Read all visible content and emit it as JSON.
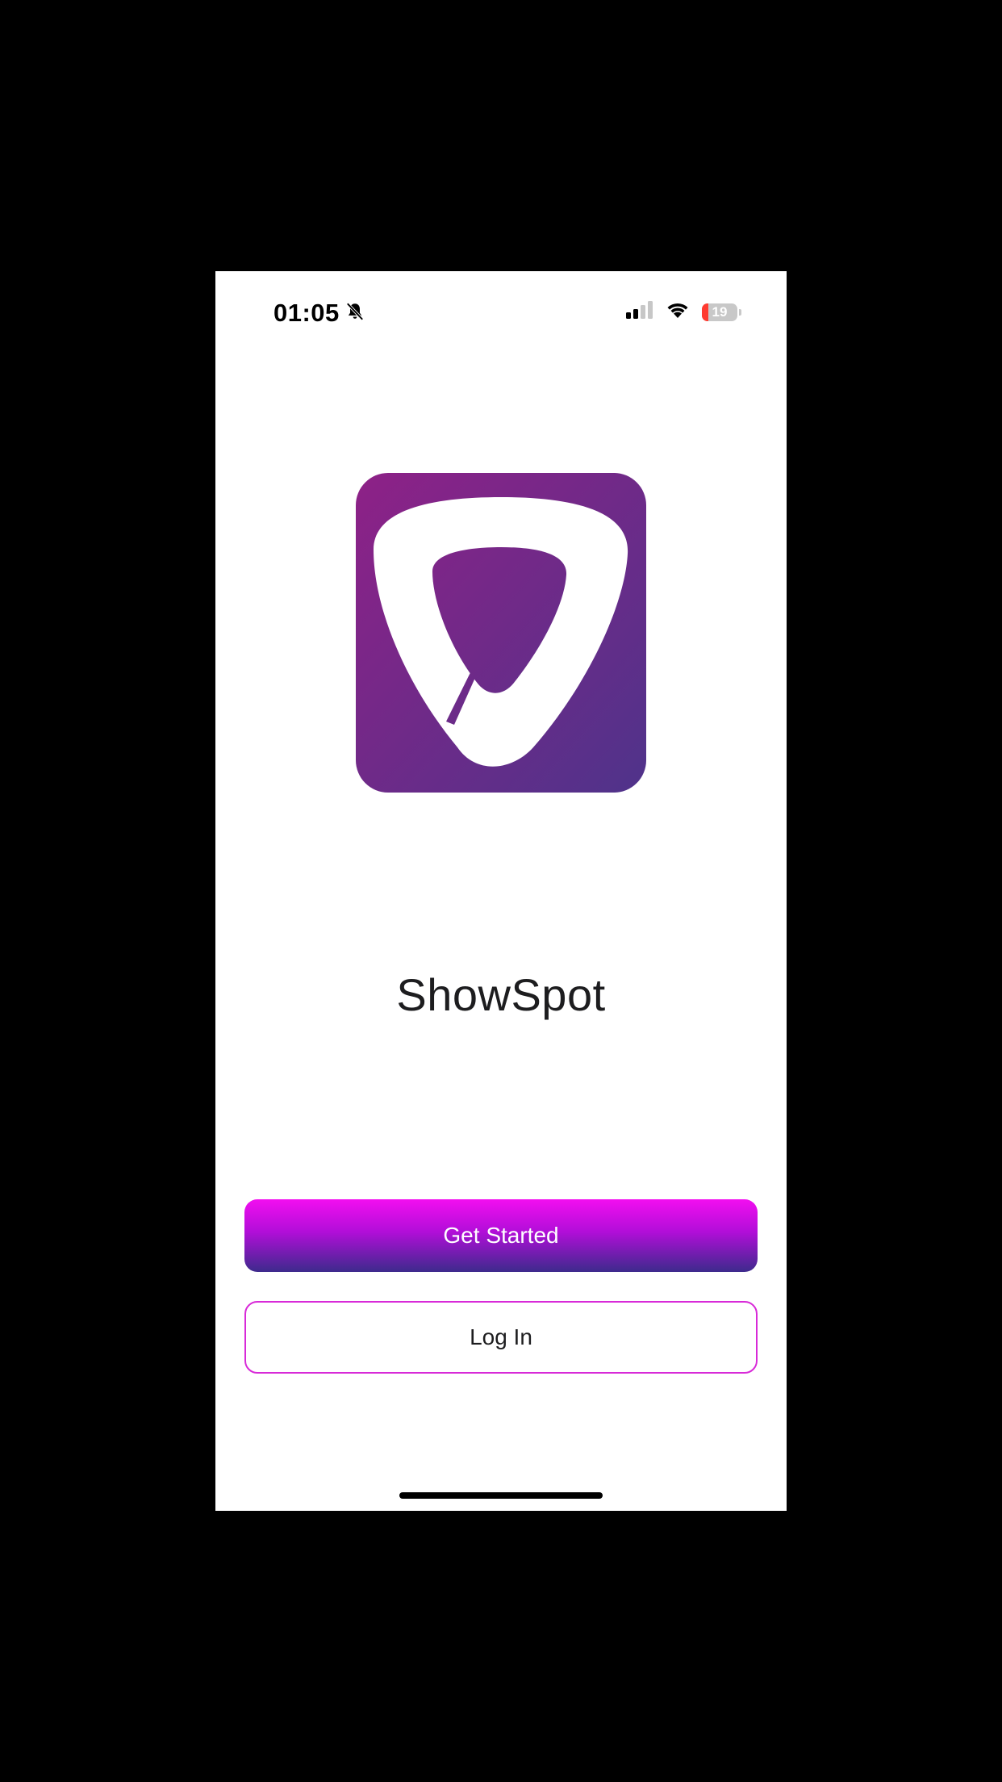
{
  "status_bar": {
    "time": "01:05",
    "battery_level": "19",
    "battery_fraction": 0.19,
    "icons": [
      "bell-slash-icon",
      "cellular-signal-icon",
      "wifi-icon",
      "battery-icon"
    ]
  },
  "logo": {
    "icon": "guitar-pick-logo-icon",
    "gradient_colors": [
      "#8e2187",
      "#4f338a"
    ]
  },
  "app": {
    "name": "ShowSpot"
  },
  "actions": {
    "get_started_label": "Get Started",
    "log_in_label": "Log In"
  },
  "colors": {
    "primary_gradient_top": "#f20ef0",
    "primary_gradient_bottom": "#3d2a8c",
    "outline_accent": "#d82ad8"
  }
}
